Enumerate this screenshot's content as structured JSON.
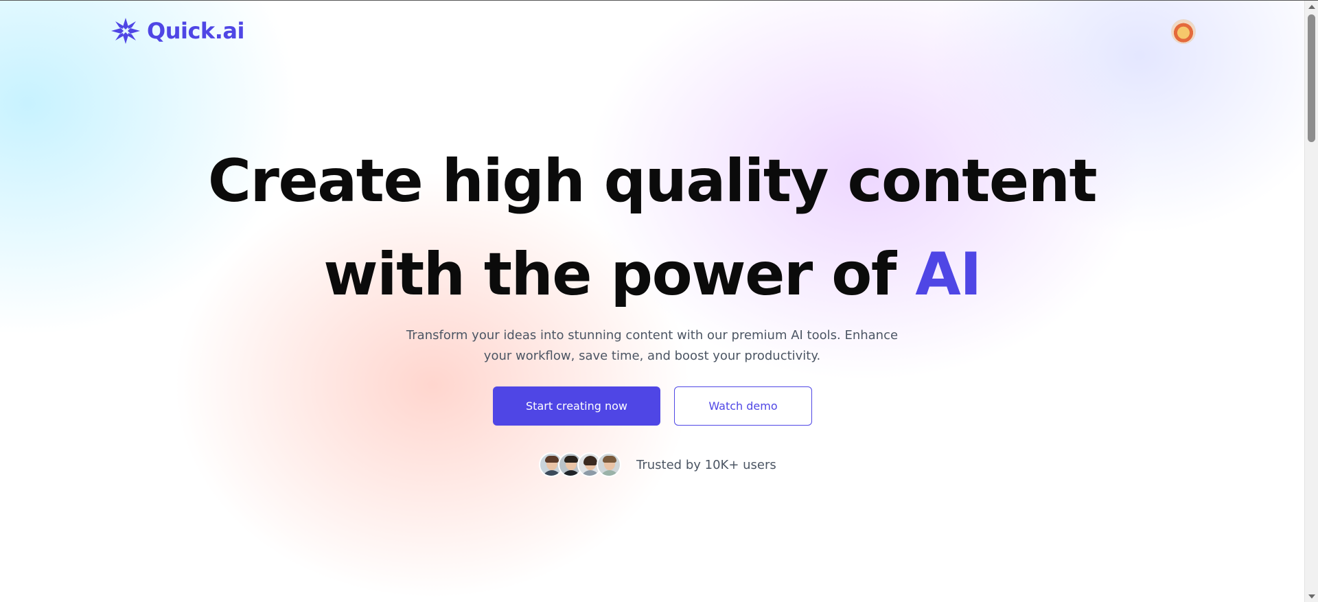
{
  "header": {
    "brand": "Quick.ai",
    "logo_icon": "sparkle-asterisk-icon",
    "user_avatar": "user-avatar"
  },
  "hero": {
    "title_line1": "Create high quality content",
    "title_line2_prefix": "with the power of ",
    "title_line2_accent": "AI",
    "subtitle": "Transform your ideas into stunning content with our premium AI tools. Enhance your workflow, save time, and boost your productivity.",
    "primary_cta": "Start creating now",
    "secondary_cta": "Watch demo",
    "trusted_text": "Trusted by 10K+ users"
  },
  "colors": {
    "accent": "#4f46e5",
    "text": "#0b0b0b",
    "muted": "#4b5563"
  }
}
